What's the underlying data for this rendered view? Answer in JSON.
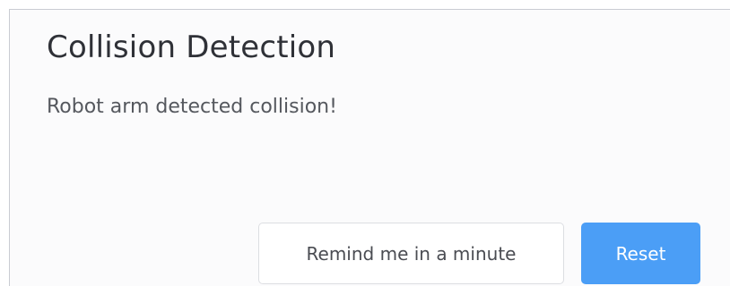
{
  "dialog": {
    "title": "Collision Detection",
    "message": "Robot arm detected collision!",
    "buttons": {
      "remind_label": "Remind me in a minute",
      "reset_label": "Reset"
    }
  },
  "colors": {
    "primary": "#4b9ef6",
    "title_text": "#2f3137",
    "body_text": "#55585e"
  }
}
